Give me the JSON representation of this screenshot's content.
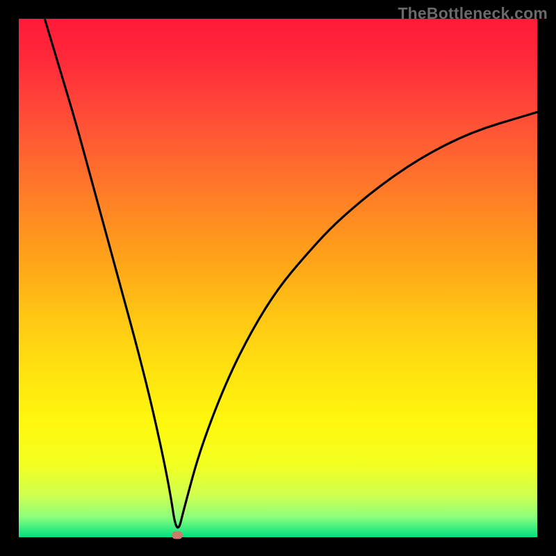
{
  "watermark": "TheBottleneck.com",
  "chart_data": {
    "type": "line",
    "title": "",
    "xlabel": "",
    "ylabel": "",
    "xlim": [
      0,
      100
    ],
    "ylim": [
      0,
      100
    ],
    "x": [
      5,
      8,
      11,
      14,
      17,
      20,
      23,
      26,
      29,
      30.5,
      32,
      35,
      40,
      45,
      50,
      55,
      60,
      65,
      70,
      75,
      80,
      85,
      90,
      95,
      100
    ],
    "y": [
      100,
      90,
      80,
      69,
      58,
      47,
      36,
      24,
      10,
      0,
      6,
      17,
      30,
      40,
      48,
      54,
      59.5,
      64,
      68,
      71.5,
      74.5,
      77,
      79,
      80.5,
      82
    ],
    "min_point": {
      "x": 30.5,
      "y": 0
    },
    "marker_color": "#cc7a6a",
    "line_color": "#000000",
    "background_gradient": [
      "#ff1a3a",
      "#ffe210",
      "#00e080"
    ]
  }
}
